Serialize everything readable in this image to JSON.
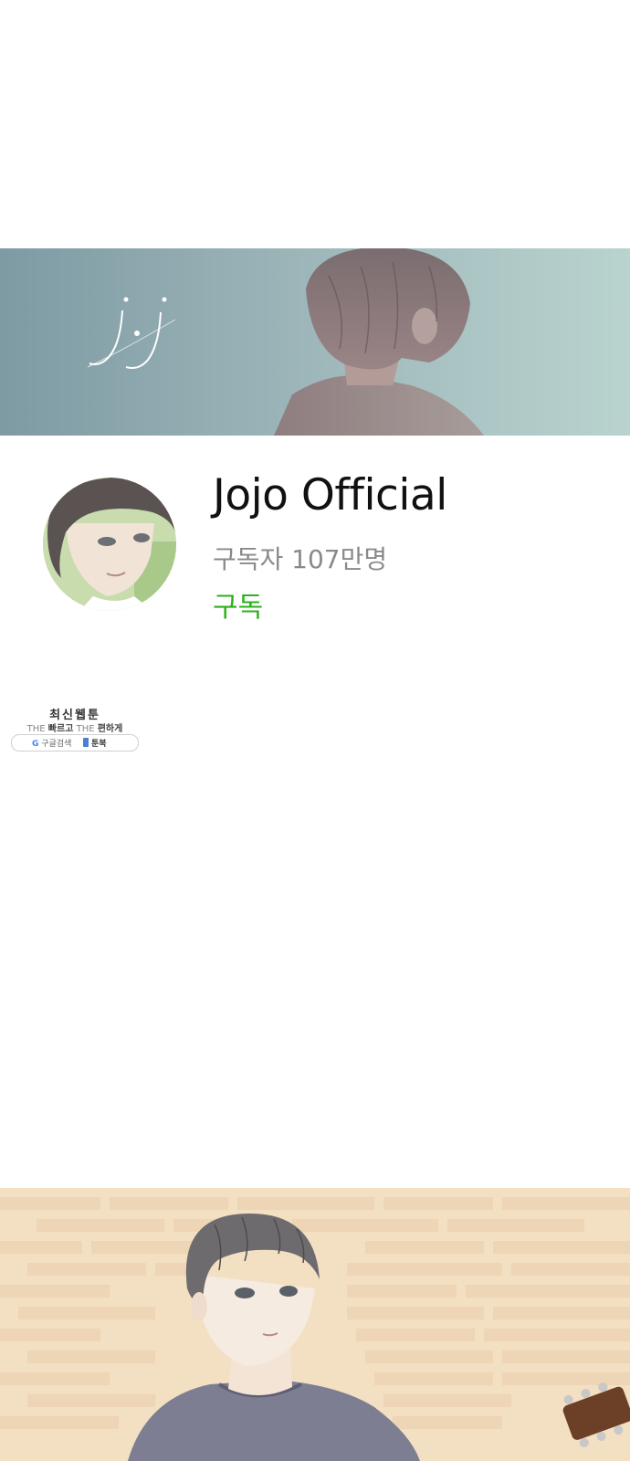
{
  "banner": {
    "logo_text": "j·j"
  },
  "profile": {
    "channel_name": "Jojo Official",
    "subscribers": "구독자 107만명",
    "subscribe_label": "구독"
  },
  "ad": {
    "title": "최신웹툰",
    "slogan_the1": "THE",
    "slogan_fast": "빠르고",
    "slogan_the2": "THE",
    "slogan_easy": "편하게",
    "google_label": "구글검색",
    "brand_label": "툰북"
  },
  "colors": {
    "subscribe_green": "#2bb21a",
    "banner_teal": "#9bb4b8"
  }
}
